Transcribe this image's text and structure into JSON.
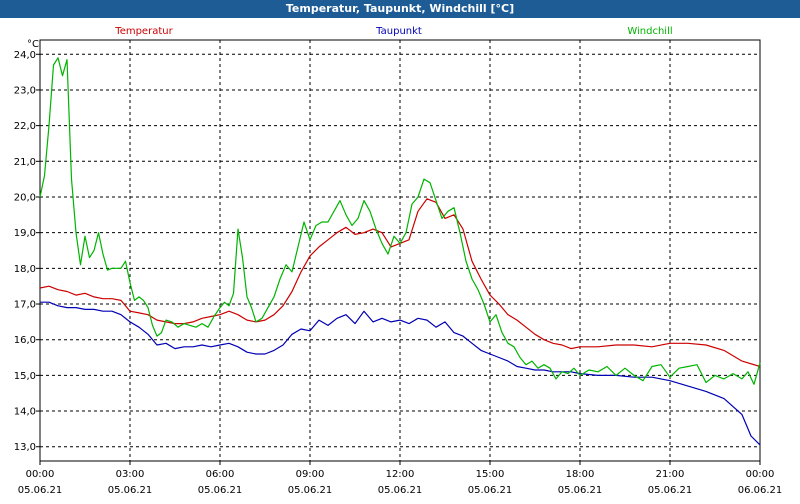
{
  "window": {
    "title": "Temperatur, Taupunkt, Windchill [°C]"
  },
  "chart_data": {
    "type": "line",
    "title": "Temperatur, Taupunkt, Windchill [°C]",
    "ylabel": "°C",
    "xlabel": "",
    "ylim": [
      12.6,
      24.4
    ],
    "xlim": [
      0,
      24
    ],
    "grid": true,
    "legend_position": "top",
    "y_ticks": [
      {
        "value": 13.0,
        "label": "13,0"
      },
      {
        "value": 14.0,
        "label": "14,0"
      },
      {
        "value": 15.0,
        "label": "15,0"
      },
      {
        "value": 16.0,
        "label": "16,0"
      },
      {
        "value": 17.0,
        "label": "17,0"
      },
      {
        "value": 18.0,
        "label": "18,0"
      },
      {
        "value": 19.0,
        "label": "19,0"
      },
      {
        "value": 20.0,
        "label": "20,0"
      },
      {
        "value": 21.0,
        "label": "21,0"
      },
      {
        "value": 22.0,
        "label": "22,0"
      },
      {
        "value": 23.0,
        "label": "23,0"
      },
      {
        "value": 24.0,
        "label": "24,0"
      }
    ],
    "x_ticks": [
      {
        "value": 0,
        "time": "00:00",
        "date": "05.06.21"
      },
      {
        "value": 3,
        "time": "03:00",
        "date": "05.06.21"
      },
      {
        "value": 6,
        "time": "06:00",
        "date": "05.06.21"
      },
      {
        "value": 9,
        "time": "09:00",
        "date": "05.06.21"
      },
      {
        "value": 12,
        "time": "12:00",
        "date": "05.06.21"
      },
      {
        "value": 15,
        "time": "15:00",
        "date": "05.06.21"
      },
      {
        "value": 18,
        "time": "18:00",
        "date": "05.06.21"
      },
      {
        "value": 21,
        "time": "21:00",
        "date": "05.06.21"
      },
      {
        "value": 24,
        "time": "00:00",
        "date": "06.06.21"
      }
    ],
    "series": [
      {
        "name": "Temperatur",
        "color": "#cc0000",
        "points": [
          [
            0,
            17.45
          ],
          [
            0.3,
            17.5
          ],
          [
            0.6,
            17.4
          ],
          [
            0.9,
            17.35
          ],
          [
            1.2,
            17.25
          ],
          [
            1.5,
            17.3
          ],
          [
            1.8,
            17.2
          ],
          [
            2.1,
            17.15
          ],
          [
            2.4,
            17.15
          ],
          [
            2.7,
            17.1
          ],
          [
            3.0,
            16.8
          ],
          [
            3.3,
            16.75
          ],
          [
            3.6,
            16.7
          ],
          [
            3.9,
            16.55
          ],
          [
            4.2,
            16.5
          ],
          [
            4.5,
            16.45
          ],
          [
            4.8,
            16.45
          ],
          [
            5.1,
            16.5
          ],
          [
            5.4,
            16.6
          ],
          [
            5.7,
            16.65
          ],
          [
            6.0,
            16.7
          ],
          [
            6.3,
            16.8
          ],
          [
            6.6,
            16.7
          ],
          [
            6.9,
            16.55
          ],
          [
            7.2,
            16.5
          ],
          [
            7.5,
            16.55
          ],
          [
            7.8,
            16.7
          ],
          [
            8.1,
            16.95
          ],
          [
            8.4,
            17.35
          ],
          [
            8.7,
            17.9
          ],
          [
            9.0,
            18.35
          ],
          [
            9.3,
            18.6
          ],
          [
            9.6,
            18.8
          ],
          [
            9.9,
            19.0
          ],
          [
            10.2,
            19.15
          ],
          [
            10.5,
            18.95
          ],
          [
            10.8,
            19.0
          ],
          [
            11.1,
            19.1
          ],
          [
            11.4,
            19.0
          ],
          [
            11.7,
            18.6
          ],
          [
            12.0,
            18.7
          ],
          [
            12.3,
            18.8
          ],
          [
            12.6,
            19.6
          ],
          [
            12.9,
            19.95
          ],
          [
            13.2,
            19.85
          ],
          [
            13.5,
            19.4
          ],
          [
            13.8,
            19.5
          ],
          [
            14.1,
            19.1
          ],
          [
            14.4,
            18.2
          ],
          [
            14.7,
            17.7
          ],
          [
            15.0,
            17.25
          ],
          [
            15.3,
            17.0
          ],
          [
            15.6,
            16.7
          ],
          [
            15.9,
            16.55
          ],
          [
            16.2,
            16.35
          ],
          [
            16.5,
            16.15
          ],
          [
            16.8,
            16.0
          ],
          [
            17.1,
            15.9
          ],
          [
            17.4,
            15.85
          ],
          [
            17.7,
            15.75
          ],
          [
            18.0,
            15.8
          ],
          [
            18.6,
            15.8
          ],
          [
            19.2,
            15.85
          ],
          [
            19.8,
            15.85
          ],
          [
            20.4,
            15.8
          ],
          [
            21.0,
            15.9
          ],
          [
            21.6,
            15.9
          ],
          [
            22.2,
            15.85
          ],
          [
            22.8,
            15.7
          ],
          [
            23.4,
            15.4
          ],
          [
            24.0,
            15.25
          ]
        ]
      },
      {
        "name": "Taupunkt",
        "color": "#0000b4",
        "points": [
          [
            0,
            17.05
          ],
          [
            0.3,
            17.05
          ],
          [
            0.6,
            16.95
          ],
          [
            0.9,
            16.9
          ],
          [
            1.2,
            16.9
          ],
          [
            1.5,
            16.85
          ],
          [
            1.8,
            16.85
          ],
          [
            2.1,
            16.8
          ],
          [
            2.4,
            16.8
          ],
          [
            2.7,
            16.7
          ],
          [
            3.0,
            16.5
          ],
          [
            3.3,
            16.35
          ],
          [
            3.6,
            16.15
          ],
          [
            3.9,
            15.85
          ],
          [
            4.2,
            15.9
          ],
          [
            4.5,
            15.75
          ],
          [
            4.8,
            15.8
          ],
          [
            5.1,
            15.8
          ],
          [
            5.4,
            15.85
          ],
          [
            5.7,
            15.8
          ],
          [
            6.0,
            15.85
          ],
          [
            6.3,
            15.9
          ],
          [
            6.6,
            15.8
          ],
          [
            6.9,
            15.65
          ],
          [
            7.2,
            15.6
          ],
          [
            7.5,
            15.6
          ],
          [
            7.8,
            15.7
          ],
          [
            8.1,
            15.85
          ],
          [
            8.4,
            16.15
          ],
          [
            8.7,
            16.3
          ],
          [
            9.0,
            16.25
          ],
          [
            9.3,
            16.55
          ],
          [
            9.6,
            16.4
          ],
          [
            9.9,
            16.6
          ],
          [
            10.2,
            16.7
          ],
          [
            10.5,
            16.45
          ],
          [
            10.8,
            16.8
          ],
          [
            11.1,
            16.5
          ],
          [
            11.4,
            16.6
          ],
          [
            11.7,
            16.5
          ],
          [
            12.0,
            16.55
          ],
          [
            12.3,
            16.45
          ],
          [
            12.6,
            16.6
          ],
          [
            12.9,
            16.55
          ],
          [
            13.2,
            16.35
          ],
          [
            13.5,
            16.5
          ],
          [
            13.8,
            16.2
          ],
          [
            14.1,
            16.1
          ],
          [
            14.4,
            15.9
          ],
          [
            14.7,
            15.7
          ],
          [
            15.0,
            15.6
          ],
          [
            15.3,
            15.5
          ],
          [
            15.6,
            15.4
          ],
          [
            15.9,
            15.25
          ],
          [
            16.2,
            15.2
          ],
          [
            16.5,
            15.15
          ],
          [
            16.8,
            15.15
          ],
          [
            17.1,
            15.1
          ],
          [
            17.4,
            15.1
          ],
          [
            17.7,
            15.1
          ],
          [
            18.0,
            15.05
          ],
          [
            18.6,
            15.0
          ],
          [
            19.2,
            15.0
          ],
          [
            19.8,
            14.95
          ],
          [
            20.4,
            14.95
          ],
          [
            21.0,
            14.85
          ],
          [
            21.6,
            14.7
          ],
          [
            22.2,
            14.55
          ],
          [
            22.8,
            14.35
          ],
          [
            23.4,
            13.9
          ],
          [
            23.7,
            13.3
          ],
          [
            24.0,
            13.05
          ]
        ]
      },
      {
        "name": "Windchill",
        "color": "#00b400",
        "points": [
          [
            0,
            20.0
          ],
          [
            0.15,
            20.6
          ],
          [
            0.3,
            22.0
          ],
          [
            0.45,
            23.7
          ],
          [
            0.6,
            23.9
          ],
          [
            0.75,
            23.4
          ],
          [
            0.9,
            23.85
          ],
          [
            1.05,
            20.5
          ],
          [
            1.2,
            19.0
          ],
          [
            1.35,
            18.1
          ],
          [
            1.5,
            18.9
          ],
          [
            1.65,
            18.3
          ],
          [
            1.8,
            18.5
          ],
          [
            1.95,
            19.0
          ],
          [
            2.1,
            18.4
          ],
          [
            2.25,
            17.95
          ],
          [
            2.4,
            18.0
          ],
          [
            2.7,
            18.0
          ],
          [
            2.85,
            18.2
          ],
          [
            3.0,
            17.6
          ],
          [
            3.15,
            17.1
          ],
          [
            3.3,
            17.2
          ],
          [
            3.45,
            17.1
          ],
          [
            3.6,
            16.9
          ],
          [
            3.75,
            16.4
          ],
          [
            3.9,
            16.1
          ],
          [
            4.05,
            16.2
          ],
          [
            4.2,
            16.55
          ],
          [
            4.4,
            16.5
          ],
          [
            4.6,
            16.35
          ],
          [
            4.8,
            16.45
          ],
          [
            5.0,
            16.4
          ],
          [
            5.2,
            16.35
          ],
          [
            5.4,
            16.45
          ],
          [
            5.6,
            16.35
          ],
          [
            5.8,
            16.65
          ],
          [
            6.0,
            16.9
          ],
          [
            6.15,
            17.05
          ],
          [
            6.3,
            16.95
          ],
          [
            6.45,
            17.3
          ],
          [
            6.6,
            19.1
          ],
          [
            6.75,
            18.3
          ],
          [
            6.9,
            17.2
          ],
          [
            7.05,
            16.9
          ],
          [
            7.2,
            16.5
          ],
          [
            7.4,
            16.6
          ],
          [
            7.6,
            16.9
          ],
          [
            7.8,
            17.2
          ],
          [
            8.0,
            17.7
          ],
          [
            8.2,
            18.1
          ],
          [
            8.4,
            17.9
          ],
          [
            8.6,
            18.6
          ],
          [
            8.8,
            19.3
          ],
          [
            9.0,
            18.8
          ],
          [
            9.2,
            19.2
          ],
          [
            9.4,
            19.3
          ],
          [
            9.6,
            19.3
          ],
          [
            9.8,
            19.6
          ],
          [
            10.0,
            19.9
          ],
          [
            10.2,
            19.5
          ],
          [
            10.4,
            19.2
          ],
          [
            10.6,
            19.4
          ],
          [
            10.8,
            19.9
          ],
          [
            11.0,
            19.6
          ],
          [
            11.2,
            19.1
          ],
          [
            11.4,
            18.7
          ],
          [
            11.6,
            18.4
          ],
          [
            11.8,
            18.9
          ],
          [
            12.0,
            18.7
          ],
          [
            12.2,
            19.0
          ],
          [
            12.4,
            19.8
          ],
          [
            12.6,
            20.0
          ],
          [
            12.8,
            20.5
          ],
          [
            13.0,
            20.4
          ],
          [
            13.2,
            19.9
          ],
          [
            13.4,
            19.4
          ],
          [
            13.6,
            19.6
          ],
          [
            13.8,
            19.7
          ],
          [
            14.0,
            19.0
          ],
          [
            14.2,
            18.2
          ],
          [
            14.4,
            17.7
          ],
          [
            14.6,
            17.4
          ],
          [
            14.8,
            17.0
          ],
          [
            15.0,
            16.5
          ],
          [
            15.2,
            16.7
          ],
          [
            15.4,
            16.2
          ],
          [
            15.6,
            15.9
          ],
          [
            15.8,
            15.8
          ],
          [
            16.0,
            15.5
          ],
          [
            16.2,
            15.3
          ],
          [
            16.4,
            15.4
          ],
          [
            16.6,
            15.2
          ],
          [
            16.8,
            15.3
          ],
          [
            17.0,
            15.2
          ],
          [
            17.2,
            14.9
          ],
          [
            17.4,
            15.1
          ],
          [
            17.6,
            15.05
          ],
          [
            17.8,
            15.2
          ],
          [
            18.0,
            15.0
          ],
          [
            18.3,
            15.15
          ],
          [
            18.6,
            15.1
          ],
          [
            18.9,
            15.25
          ],
          [
            19.2,
            15.0
          ],
          [
            19.5,
            15.2
          ],
          [
            19.8,
            15.0
          ],
          [
            20.1,
            14.85
          ],
          [
            20.4,
            15.25
          ],
          [
            20.7,
            15.3
          ],
          [
            21.0,
            14.95
          ],
          [
            21.3,
            15.2
          ],
          [
            21.6,
            15.25
          ],
          [
            21.9,
            15.3
          ],
          [
            22.2,
            14.8
          ],
          [
            22.5,
            15.0
          ],
          [
            22.8,
            14.9
          ],
          [
            23.1,
            15.05
          ],
          [
            23.4,
            14.9
          ],
          [
            23.6,
            15.1
          ],
          [
            23.8,
            14.75
          ],
          [
            24.0,
            15.35
          ]
        ]
      }
    ]
  }
}
